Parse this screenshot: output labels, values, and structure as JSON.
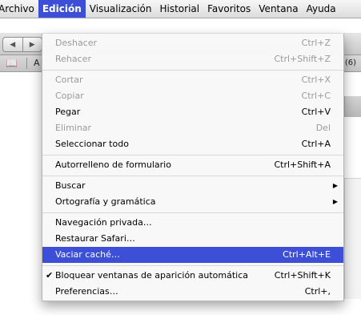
{
  "menubar": {
    "items": [
      {
        "label": "Archivo"
      },
      {
        "label": "Edición"
      },
      {
        "label": "Visualización"
      },
      {
        "label": "Historial"
      },
      {
        "label": "Favoritos"
      },
      {
        "label": "Ventana"
      },
      {
        "label": "Ayuda"
      }
    ]
  },
  "toolbar": {
    "back_icon": "back-arrow-icon",
    "forward_icon": "forward-arrow-icon",
    "back_glyph": "◀",
    "forward_glyph": "▶"
  },
  "bookmarks": {
    "book_icon": "bookmarks-book-icon",
    "book_glyph": "📖",
    "partial_text": "A",
    "right_text": "(6)"
  },
  "menu": {
    "items": [
      {
        "label": "Deshacer",
        "shortcut": "Ctrl+Z",
        "disabled": true
      },
      {
        "label": "Rehacer",
        "shortcut": "Ctrl+Shift+Z",
        "disabled": true
      },
      {
        "label": "Cortar",
        "shortcut": "Ctrl+X",
        "disabled": true
      },
      {
        "label": "Copiar",
        "shortcut": "Ctrl+C",
        "disabled": true
      },
      {
        "label": "Pegar",
        "shortcut": "Ctrl+V",
        "disabled": false
      },
      {
        "label": "Eliminar",
        "shortcut": "Del",
        "disabled": true
      },
      {
        "label": "Seleccionar todo",
        "shortcut": "Ctrl+A",
        "disabled": false
      },
      {
        "label": "Autorrelleno de formulario",
        "shortcut": "Ctrl+Shift+A",
        "disabled": false
      },
      {
        "label": "Buscar",
        "submenu": true
      },
      {
        "label": "Ortografía y gramática",
        "submenu": true
      },
      {
        "label": "Navegación privada…",
        "shortcut": ""
      },
      {
        "label": "Restaurar Safari…",
        "shortcut": ""
      },
      {
        "label": "Vaciar caché…",
        "shortcut": "Ctrl+Alt+E",
        "highlighted": true
      },
      {
        "label": "Bloquear ventanas de aparición automática",
        "shortcut": "Ctrl+Shift+K",
        "checked": true
      },
      {
        "label": "Preferencias…",
        "shortcut": "Ctrl+,"
      }
    ],
    "check_glyph": "✔",
    "submenu_glyph": "▶"
  },
  "colors": {
    "highlight": "#3c4fd6",
    "disabled_text": "#9a9a9a"
  }
}
